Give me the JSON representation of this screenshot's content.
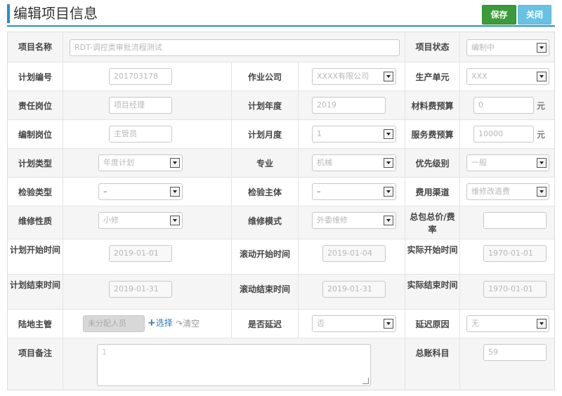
{
  "header": {
    "title": "编辑项目信息",
    "save_label": "保存",
    "close_label": "关闭"
  },
  "colors": {
    "accent": "#2a8fbd",
    "save": "#3b9b3b",
    "close": "#69c2e4"
  },
  "form": {
    "project_name": {
      "label": "项目名称",
      "value": "RDT-调控类审批流程测试"
    },
    "project_status": {
      "label": "项目状态",
      "value": "编制中"
    },
    "plan_no": {
      "label": "计划编号",
      "value": "201703178"
    },
    "company": {
      "label": "作业公司",
      "value": "XXXX有限公司"
    },
    "unit": {
      "label": "生产单元",
      "value": "XXX"
    },
    "resp_post": {
      "label": "责任岗位",
      "value": "项目经理"
    },
    "plan_year": {
      "label": "计划年度",
      "value": "2019"
    },
    "material_budget": {
      "label": "材料费预算",
      "value": "0",
      "unit": "元"
    },
    "edit_post": {
      "label": "编制岗位",
      "value": "主管员"
    },
    "plan_month": {
      "label": "计划月度",
      "value": "1"
    },
    "service_budget": {
      "label": "服务费预算",
      "value": "10000",
      "unit": "元"
    },
    "plan_type": {
      "label": "计划类型",
      "value": "年度计划"
    },
    "specialty": {
      "label": "专业",
      "value": "机械"
    },
    "priority": {
      "label": "优先级别",
      "value": "一般"
    },
    "inspect_type": {
      "label": "检验类型",
      "value": "–"
    },
    "inspect_body": {
      "label": "检验主体",
      "value": "–"
    },
    "fee_channel": {
      "label": "费用渠道",
      "value": "维修改造费"
    },
    "maint_nature": {
      "label": "维修性质",
      "value": "小修"
    },
    "maint_mode": {
      "label": "维修模式",
      "value": "外委维修"
    },
    "package_price": {
      "label": "总包总价/费率",
      "value": ""
    },
    "plan_start": {
      "label": "计划开始时间",
      "value": "2019-01-01"
    },
    "roll_start": {
      "label": "滚动开始时间",
      "value": "2019-01-04"
    },
    "actual_start": {
      "label": "实际开始时间",
      "value": "1970-01-01"
    },
    "plan_end": {
      "label": "计划结束时间",
      "value": "2019-01-31"
    },
    "roll_end": {
      "label": "滚动结束时间",
      "value": "2019-01-31"
    },
    "actual_end": {
      "label": "实际结束时间",
      "value": "1970-01-01"
    },
    "land_manager": {
      "label": "陆地主管",
      "value": "未分配人员",
      "select_label": "选择",
      "clear_label": "清空"
    },
    "is_delayed": {
      "label": "是否延迟",
      "value": "否"
    },
    "delay_reason": {
      "label": "延迟原因",
      "value": "无"
    },
    "remarks": {
      "label": "项目备注",
      "value": "1"
    },
    "ledger": {
      "label": "总账科目",
      "value": "59"
    }
  }
}
